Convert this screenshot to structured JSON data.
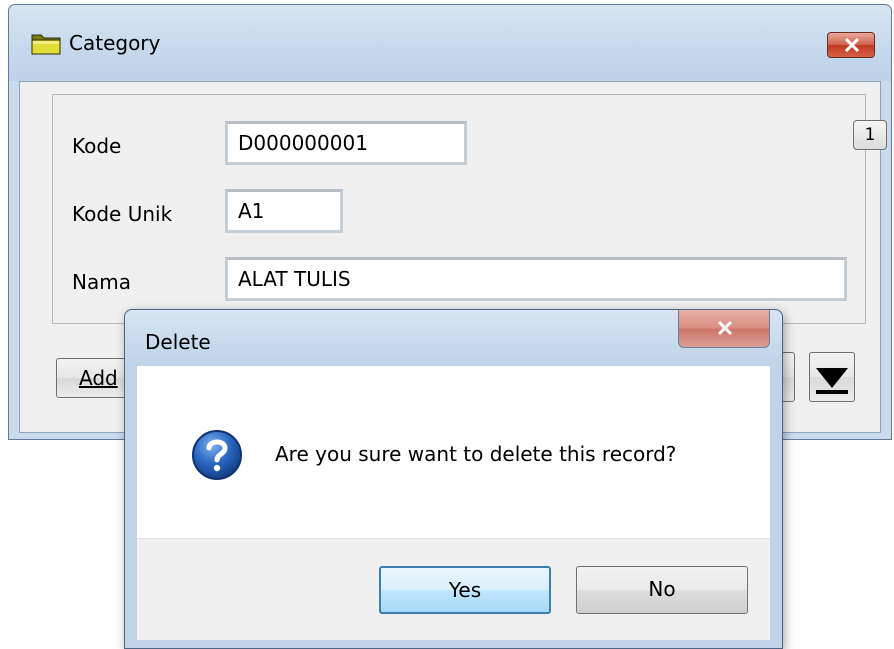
{
  "category_window": {
    "title": "Category",
    "title_icon": "folder-icon",
    "close_icon": "close-icon",
    "record_badge": "1",
    "fields": {
      "kode_label": "Kode",
      "kode_value": "D000000001",
      "kode_unik_label": "Kode Unik",
      "kode_unik_value": "A1",
      "nama_label": "Nama",
      "nama_value": "ALAT TULIS"
    },
    "add_button_label_underlined": "Add",
    "last_record_icon": "last-record-icon"
  },
  "delete_dialog": {
    "title": "Delete",
    "close_icon": "close-icon",
    "icon": "question-icon",
    "message": "Are you sure want to delete this record?",
    "yes_label": "Yes",
    "no_label": "No"
  },
  "colors": {
    "title_bar": "#c9dbed",
    "close_red": "#c0391f",
    "yes_focus_border": "#3c7fb1",
    "question_blue": "#1f5fb4"
  }
}
